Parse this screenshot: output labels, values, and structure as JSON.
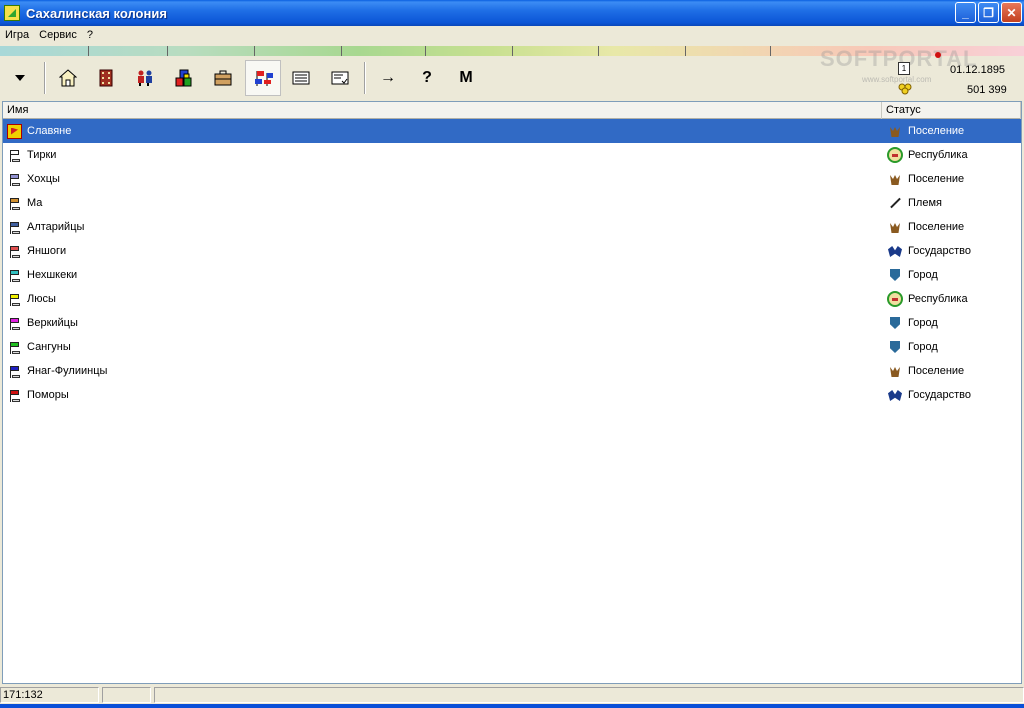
{
  "window": {
    "title": "Сахалинская колония"
  },
  "menu": [
    "Игра",
    "Сервис",
    "?"
  ],
  "toolbar": {
    "buttons": [
      {
        "icon": "dropdown-arrow-icon"
      },
      {
        "icon": "home-icon"
      },
      {
        "icon": "building-icon"
      },
      {
        "icon": "people-icon"
      },
      {
        "icon": "resources-icon"
      },
      {
        "icon": "briefcase-icon"
      },
      {
        "icon": "nations-flags-icon",
        "active": true
      },
      {
        "icon": "list-icon"
      },
      {
        "icon": "document-icon"
      },
      {
        "icon": "arrow-right-icon",
        "glyph": "→"
      },
      {
        "icon": "question-icon",
        "glyph": "?"
      },
      {
        "icon": "map-m-icon",
        "glyph": "M"
      }
    ],
    "date": "01.12.1895",
    "money": "501 399",
    "calendar_day": "1"
  },
  "watermark": {
    "text": "SOFTPORTAL",
    "url": "www.softportal.com"
  },
  "list": {
    "columns": {
      "name": "Имя",
      "status": "Статус"
    },
    "rows": [
      {
        "name": "Славяне",
        "status": "Поселение",
        "status_icon": "settlement",
        "flag_color": "#d02020",
        "selected": true
      },
      {
        "name": "Тирки",
        "status": "Республика",
        "status_icon": "republic",
        "flag_color": "#ffffff"
      },
      {
        "name": "Хохцы",
        "status": "Поселение",
        "status_icon": "settlement",
        "flag_color": "#9090d0"
      },
      {
        "name": "Ма",
        "status": "Племя",
        "status_icon": "tribe",
        "flag_color": "#d09030"
      },
      {
        "name": "Алтарийцы",
        "status": "Поселение",
        "status_icon": "settlement",
        "flag_color": "#4060a0"
      },
      {
        "name": "Яншоги",
        "status": "Государство",
        "status_icon": "state",
        "flag_color": "#e05050"
      },
      {
        "name": "Нехшкеки",
        "status": "Город",
        "status_icon": "city",
        "flag_color": "#30c0c0"
      },
      {
        "name": "Люсы",
        "status": "Республика",
        "status_icon": "republic",
        "flag_color": "#f0f000"
      },
      {
        "name": "Веркийцы",
        "status": "Город",
        "status_icon": "city",
        "flag_color": "#e020e0"
      },
      {
        "name": "Сангуны",
        "status": "Город",
        "status_icon": "city",
        "flag_color": "#20c020"
      },
      {
        "name": "Янаг-Фулиинцы",
        "status": "Поселение",
        "status_icon": "settlement",
        "flag_color": "#2020c0"
      },
      {
        "name": "Поморы",
        "status": "Государство",
        "status_icon": "state",
        "flag_color": "#d01010"
      }
    ]
  },
  "statusbar": {
    "coords": "171:132"
  }
}
